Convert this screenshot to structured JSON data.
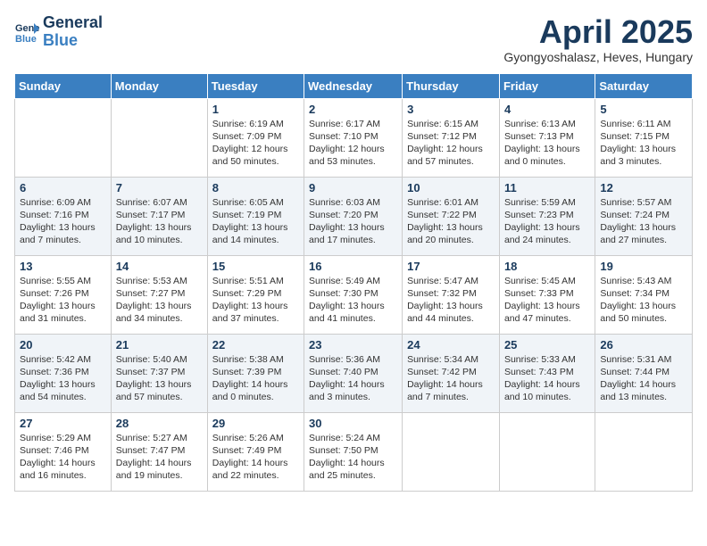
{
  "header": {
    "logo_general": "General",
    "logo_blue": "Blue",
    "month_title": "April 2025",
    "location": "Gyongyoshalasz, Heves, Hungary"
  },
  "calendar": {
    "days_of_week": [
      "Sunday",
      "Monday",
      "Tuesday",
      "Wednesday",
      "Thursday",
      "Friday",
      "Saturday"
    ],
    "weeks": [
      [
        {
          "day": "",
          "info": ""
        },
        {
          "day": "",
          "info": ""
        },
        {
          "day": "1",
          "info": "Sunrise: 6:19 AM\nSunset: 7:09 PM\nDaylight: 12 hours and 50 minutes."
        },
        {
          "day": "2",
          "info": "Sunrise: 6:17 AM\nSunset: 7:10 PM\nDaylight: 12 hours and 53 minutes."
        },
        {
          "day": "3",
          "info": "Sunrise: 6:15 AM\nSunset: 7:12 PM\nDaylight: 12 hours and 57 minutes."
        },
        {
          "day": "4",
          "info": "Sunrise: 6:13 AM\nSunset: 7:13 PM\nDaylight: 13 hours and 0 minutes."
        },
        {
          "day": "5",
          "info": "Sunrise: 6:11 AM\nSunset: 7:15 PM\nDaylight: 13 hours and 3 minutes."
        }
      ],
      [
        {
          "day": "6",
          "info": "Sunrise: 6:09 AM\nSunset: 7:16 PM\nDaylight: 13 hours and 7 minutes."
        },
        {
          "day": "7",
          "info": "Sunrise: 6:07 AM\nSunset: 7:17 PM\nDaylight: 13 hours and 10 minutes."
        },
        {
          "day": "8",
          "info": "Sunrise: 6:05 AM\nSunset: 7:19 PM\nDaylight: 13 hours and 14 minutes."
        },
        {
          "day": "9",
          "info": "Sunrise: 6:03 AM\nSunset: 7:20 PM\nDaylight: 13 hours and 17 minutes."
        },
        {
          "day": "10",
          "info": "Sunrise: 6:01 AM\nSunset: 7:22 PM\nDaylight: 13 hours and 20 minutes."
        },
        {
          "day": "11",
          "info": "Sunrise: 5:59 AM\nSunset: 7:23 PM\nDaylight: 13 hours and 24 minutes."
        },
        {
          "day": "12",
          "info": "Sunrise: 5:57 AM\nSunset: 7:24 PM\nDaylight: 13 hours and 27 minutes."
        }
      ],
      [
        {
          "day": "13",
          "info": "Sunrise: 5:55 AM\nSunset: 7:26 PM\nDaylight: 13 hours and 31 minutes."
        },
        {
          "day": "14",
          "info": "Sunrise: 5:53 AM\nSunset: 7:27 PM\nDaylight: 13 hours and 34 minutes."
        },
        {
          "day": "15",
          "info": "Sunrise: 5:51 AM\nSunset: 7:29 PM\nDaylight: 13 hours and 37 minutes."
        },
        {
          "day": "16",
          "info": "Sunrise: 5:49 AM\nSunset: 7:30 PM\nDaylight: 13 hours and 41 minutes."
        },
        {
          "day": "17",
          "info": "Sunrise: 5:47 AM\nSunset: 7:32 PM\nDaylight: 13 hours and 44 minutes."
        },
        {
          "day": "18",
          "info": "Sunrise: 5:45 AM\nSunset: 7:33 PM\nDaylight: 13 hours and 47 minutes."
        },
        {
          "day": "19",
          "info": "Sunrise: 5:43 AM\nSunset: 7:34 PM\nDaylight: 13 hours and 50 minutes."
        }
      ],
      [
        {
          "day": "20",
          "info": "Sunrise: 5:42 AM\nSunset: 7:36 PM\nDaylight: 13 hours and 54 minutes."
        },
        {
          "day": "21",
          "info": "Sunrise: 5:40 AM\nSunset: 7:37 PM\nDaylight: 13 hours and 57 minutes."
        },
        {
          "day": "22",
          "info": "Sunrise: 5:38 AM\nSunset: 7:39 PM\nDaylight: 14 hours and 0 minutes."
        },
        {
          "day": "23",
          "info": "Sunrise: 5:36 AM\nSunset: 7:40 PM\nDaylight: 14 hours and 3 minutes."
        },
        {
          "day": "24",
          "info": "Sunrise: 5:34 AM\nSunset: 7:42 PM\nDaylight: 14 hours and 7 minutes."
        },
        {
          "day": "25",
          "info": "Sunrise: 5:33 AM\nSunset: 7:43 PM\nDaylight: 14 hours and 10 minutes."
        },
        {
          "day": "26",
          "info": "Sunrise: 5:31 AM\nSunset: 7:44 PM\nDaylight: 14 hours and 13 minutes."
        }
      ],
      [
        {
          "day": "27",
          "info": "Sunrise: 5:29 AM\nSunset: 7:46 PM\nDaylight: 14 hours and 16 minutes."
        },
        {
          "day": "28",
          "info": "Sunrise: 5:27 AM\nSunset: 7:47 PM\nDaylight: 14 hours and 19 minutes."
        },
        {
          "day": "29",
          "info": "Sunrise: 5:26 AM\nSunset: 7:49 PM\nDaylight: 14 hours and 22 minutes."
        },
        {
          "day": "30",
          "info": "Sunrise: 5:24 AM\nSunset: 7:50 PM\nDaylight: 14 hours and 25 minutes."
        },
        {
          "day": "",
          "info": ""
        },
        {
          "day": "",
          "info": ""
        },
        {
          "day": "",
          "info": ""
        }
      ]
    ]
  }
}
